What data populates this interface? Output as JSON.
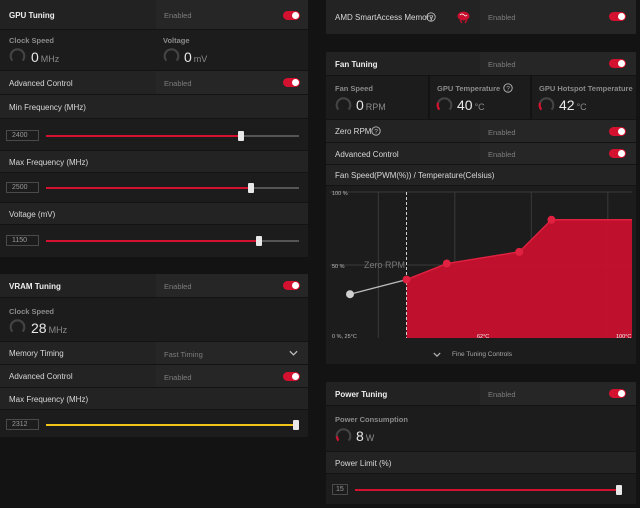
{
  "gpu": {
    "title": "GPU Tuning",
    "status": "Enabled",
    "enabled": true,
    "clock_speed": {
      "label": "Clock Speed",
      "value": "0",
      "unit": "MHz"
    },
    "voltage": {
      "label": "Voltage",
      "value": "0",
      "unit": "mV"
    },
    "advanced_control": {
      "label": "Advanced Control",
      "status": "Enabled",
      "enabled": true
    },
    "min_freq": {
      "label": "Min Frequency (MHz)",
      "value": "2400",
      "fraction": 0.77
    },
    "max_freq": {
      "label": "Max Frequency (MHz)",
      "value": "2500",
      "fraction": 0.81
    },
    "voltage_slider": {
      "label": "Voltage (mV)",
      "value": "1150",
      "fraction": 0.84
    }
  },
  "vram": {
    "title": "VRAM Tuning",
    "status": "Enabled",
    "enabled": true,
    "clock_speed": {
      "label": "Clock Speed",
      "value": "28",
      "unit": "MHz"
    },
    "memory_timing": {
      "label": "Memory Timing",
      "value": "Fast Timing"
    },
    "advanced_control": {
      "label": "Advanced Control",
      "status": "Enabled",
      "enabled": true
    },
    "max_freq": {
      "label": "Max Frequency (MHz)",
      "value": "2312",
      "fraction": 1.0,
      "color": "#f0c419"
    }
  },
  "sam": {
    "label": "AMD SmartAccess Memory",
    "status": "Enabled",
    "enabled": true,
    "icon": "question-circle-icon",
    "badge_icon": "brain-icon"
  },
  "fan": {
    "title": "Fan Tuning",
    "status": "Enabled",
    "enabled": true,
    "fan_speed": {
      "label": "Fan Speed",
      "value": "0",
      "unit": "RPM"
    },
    "gpu_temp": {
      "label": "GPU Temperature",
      "value": "40",
      "unit": "°C"
    },
    "hotspot_temp": {
      "label": "GPU Hotspot Temperature",
      "value": "42",
      "unit": "°C"
    },
    "zero_rpm": {
      "label": "Zero RPM",
      "status": "Enabled",
      "enabled": true
    },
    "advanced_control": {
      "label": "Advanced Control",
      "status": "Enabled",
      "enabled": true
    },
    "curve_title": "Fan Speed(PWM(%)) / Temperature(Celsius)",
    "fine_tuning": "Fine Tuning Controls"
  },
  "chart_data": {
    "type": "area",
    "title": "Fan Speed(PWM(%)) / Temperature(Celsius)",
    "x_unit": "°C",
    "y_unit": "%",
    "xlim": [
      25,
      100
    ],
    "ylim": [
      0,
      100
    ],
    "y_ticks": [
      "100 %",
      "50 %",
      "0 %, 25°C"
    ],
    "x_ticks": [
      "62°C",
      "100°C"
    ],
    "zero_rpm_label": "Zero RPM",
    "zero_rpm_point": {
      "x": 25,
      "y": 30
    },
    "points": [
      {
        "x": 44,
        "y": 40
      },
      {
        "x": 54,
        "y": 51
      },
      {
        "x": 72,
        "y": 59
      },
      {
        "x": 80,
        "y": 81
      }
    ],
    "end_value": 81,
    "accent": "#c8102e"
  },
  "power": {
    "title": "Power Tuning",
    "status": "Enabled",
    "enabled": true,
    "consumption": {
      "label": "Power Consumption",
      "value": "8",
      "unit": "W"
    },
    "limit": {
      "label": "Power Limit (%)",
      "value": "15",
      "fraction": 1.0
    }
  }
}
